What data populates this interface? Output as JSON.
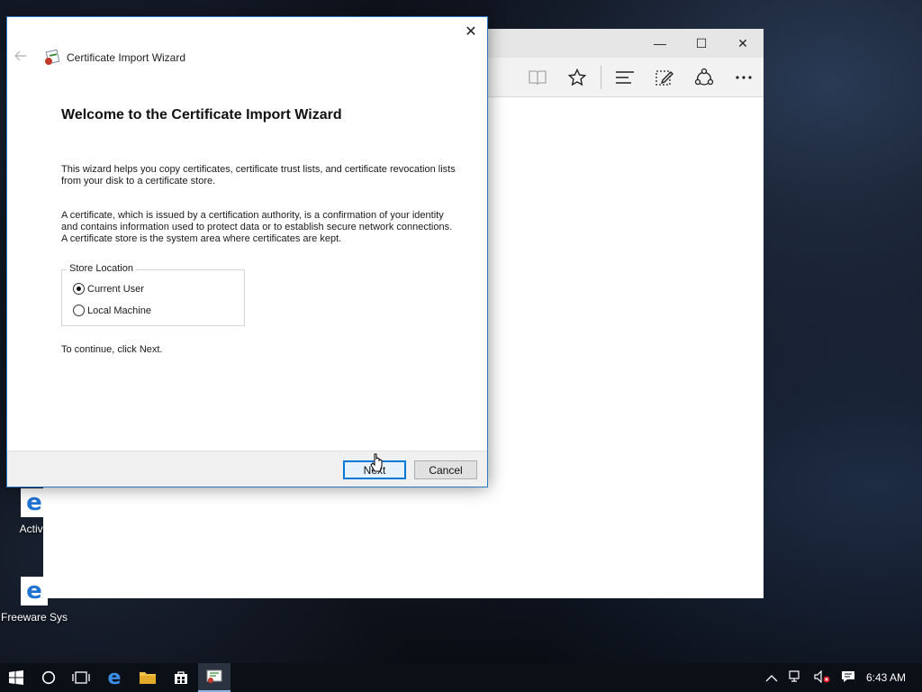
{
  "desktop": {
    "icons": [
      {
        "label": "Activa"
      },
      {
        "label": "Freeware Sys"
      }
    ]
  },
  "edge": {
    "caption_buttons": {
      "minimize": "—",
      "maximize": "☐",
      "close": "✕"
    },
    "toolbar_icons": [
      "reading-view-icon",
      "favorites-icon",
      "hub-icon",
      "web-note-icon",
      "share-icon",
      "more-icon"
    ]
  },
  "wizard": {
    "title": "Certificate Import Wizard",
    "close": "✕",
    "heading": "Welcome to the Certificate Import Wizard",
    "para1": "This wizard helps you copy certificates, certificate trust lists, and certificate revocation lists from your disk to a certificate store.",
    "para2": "A certificate, which is issued by a certification authority, is a confirmation of your identity and contains information used to protect data or to establish secure network connections. A certificate store is the system area where certificates are kept.",
    "store_location": {
      "legend": "Store Location",
      "options": [
        {
          "label": "Current User",
          "selected": true
        },
        {
          "label": "Local Machine",
          "selected": false
        }
      ]
    },
    "continue_text": "To continue, click Next.",
    "buttons": {
      "next": "Next",
      "cancel": "Cancel"
    }
  },
  "taskbar": {
    "clock": "6:43 AM"
  }
}
